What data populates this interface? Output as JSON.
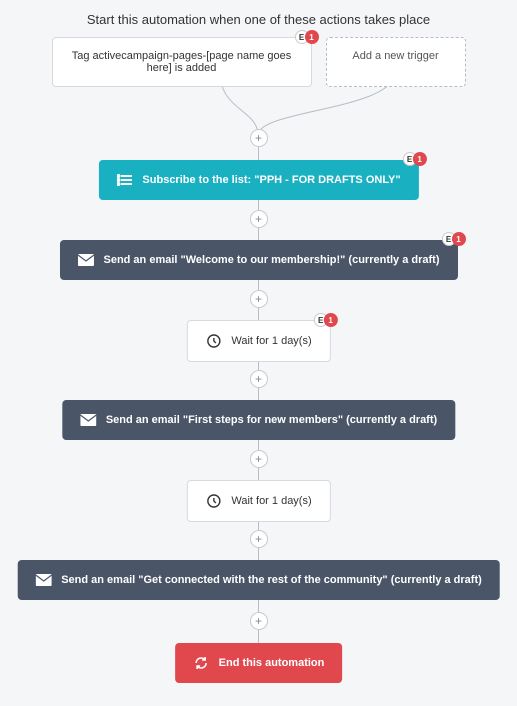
{
  "heading": "Start this automation when one of these actions takes place",
  "trigger": {
    "label": "Tag activecampaign-pages-[page name goes here] is added",
    "badge_e": "E",
    "badge_n": "1"
  },
  "add_trigger": {
    "label": "Add a new trigger"
  },
  "plus_glyph": "+",
  "steps": [
    {
      "label": "Subscribe to the list: \"PPH - FOR DRAFTS ONLY\"",
      "badge_e": "E",
      "badge_n": "1"
    },
    {
      "label": "Send an email \"Welcome to our membership!\" (currently a draft)",
      "badge_e": "E",
      "badge_n": "1"
    },
    {
      "label": "Wait for 1 day(s)",
      "badge_e": "E",
      "badge_n": "1"
    },
    {
      "label": "Send an email \"First steps for new members\" (currently a draft)"
    },
    {
      "label": "Wait for 1 day(s)"
    },
    {
      "label": "Send an email \"Get connected with the rest of the community\" (currently a draft)"
    },
    {
      "label": "End this automation"
    }
  ]
}
